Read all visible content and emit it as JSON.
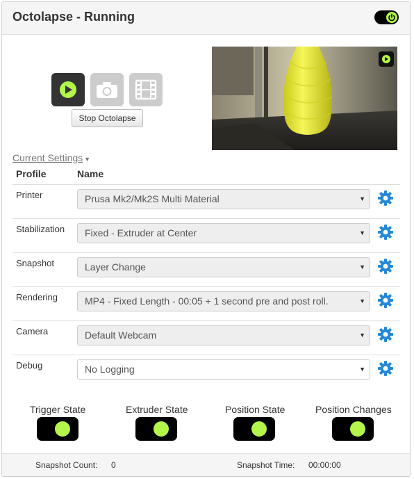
{
  "header": {
    "title": "Octolapse - Running"
  },
  "controls": {
    "stop_label": "Stop Octolapse"
  },
  "settings": {
    "link_label": "Current Settings",
    "columns": [
      "Profile",
      "Name"
    ],
    "rows": [
      {
        "profile": "Printer",
        "value": "Prusa Mk2/Mk2S Multi Material"
      },
      {
        "profile": "Stabilization",
        "value": "Fixed - Extruder at Center"
      },
      {
        "profile": "Snapshot",
        "value": "Layer Change"
      },
      {
        "profile": "Rendering",
        "value": "MP4 - Fixed Length - 00:05 + 1 second pre and post roll."
      },
      {
        "profile": "Camera",
        "value": "Default Webcam"
      },
      {
        "profile": "Debug",
        "value": "No Logging"
      }
    ]
  },
  "states": [
    "Trigger State",
    "Extruder State",
    "Position State",
    "Position Changes"
  ],
  "footer": {
    "snapshot_count_label": "Snapshot Count:",
    "snapshot_count": "0",
    "snapshot_time_label": "Snapshot Time:",
    "snapshot_time": "00:00:00"
  },
  "colors": {
    "accent_green": "#b3f54a",
    "gear_blue": "#2389d7",
    "dark": "#333333"
  },
  "icons": [
    "power-icon",
    "play-icon",
    "camera-icon",
    "film-icon",
    "gear-icon",
    "caret-down-icon"
  ]
}
